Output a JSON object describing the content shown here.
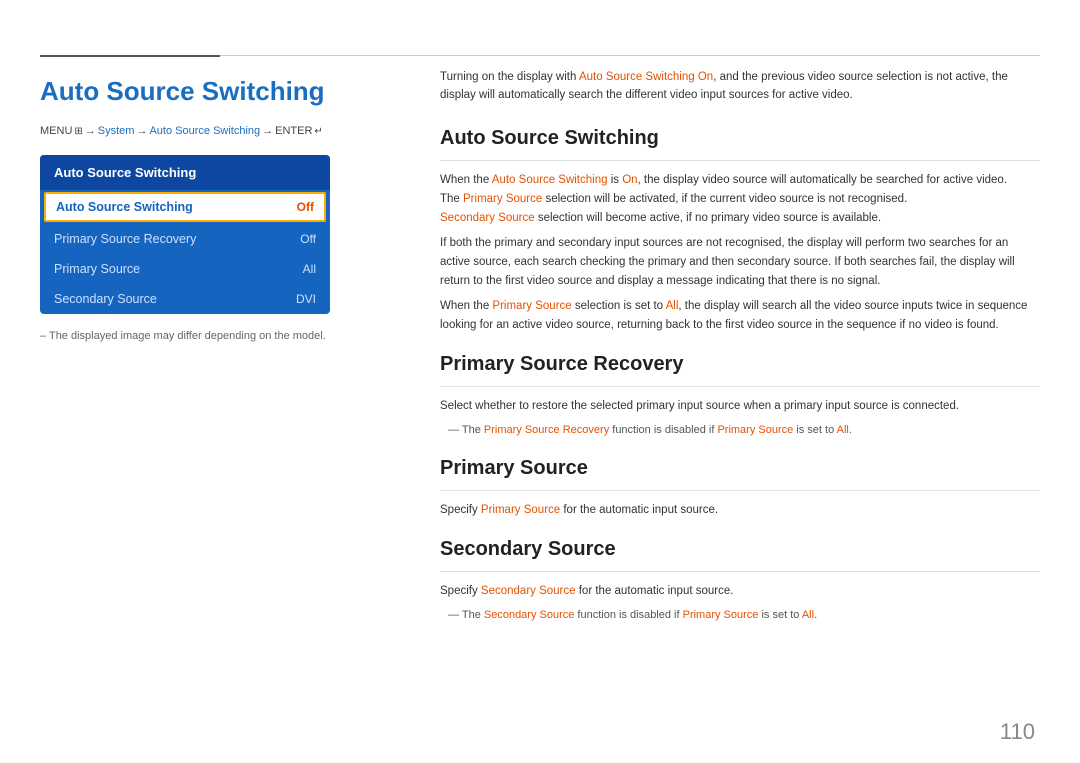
{
  "page": {
    "number": "110"
  },
  "header": {
    "main_title": "Auto Source Switching",
    "breadcrumb": {
      "menu": "MENU",
      "menu_icon": "≡",
      "enter_icon": "↵",
      "arrow": "→",
      "system": "System",
      "auto_source": "Auto Source Switching",
      "enter": "ENTER"
    }
  },
  "menu_panel": {
    "title": "Auto Source Switching",
    "items": [
      {
        "label": "Auto Source Switching",
        "value": "Off",
        "selected": true
      },
      {
        "label": "Primary Source Recovery",
        "value": "Off",
        "selected": false
      },
      {
        "label": "Primary Source",
        "value": "All",
        "selected": false
      },
      {
        "label": "Secondary Source",
        "value": "DVI",
        "selected": false
      }
    ]
  },
  "note": "– The displayed image may differ depending on the model.",
  "intro": {
    "text1": "Turning on the display with ",
    "highlight1": "Auto Source Switching On",
    "text2": ", and the previous video source selection is not active, the display will automatically search the different video input sources for active video."
  },
  "sections": [
    {
      "id": "auto-source-switching",
      "title": "Auto Source Switching",
      "paragraphs": [
        {
          "parts": [
            {
              "text": "When the ",
              "style": "normal"
            },
            {
              "text": "Auto Source Switching",
              "style": "orange"
            },
            {
              "text": " is ",
              "style": "normal"
            },
            {
              "text": "On",
              "style": "orange"
            },
            {
              "text": ", the display video source will automatically be searched for active video.",
              "style": "normal"
            }
          ]
        },
        {
          "parts": [
            {
              "text": "The ",
              "style": "normal"
            },
            {
              "text": "Primary Source",
              "style": "orange"
            },
            {
              "text": " selection will be activated, if the current video source is not recognised.",
              "style": "normal"
            }
          ]
        },
        {
          "parts": [
            {
              "text": "Secondary Source",
              "style": "orange"
            },
            {
              "text": " selection will become active, if no primary video source is available.",
              "style": "normal"
            }
          ]
        },
        {
          "parts": [
            {
              "text": "If both the primary and secondary input sources are not recognised, the display will perform two searches for an active source, each search checking the primary and then secondary source. If both searches fail, the display will return to the first video source and display a message indicating that there is no signal.",
              "style": "normal"
            }
          ]
        },
        {
          "parts": [
            {
              "text": "When the ",
              "style": "normal"
            },
            {
              "text": "Primary Source",
              "style": "orange"
            },
            {
              "text": " selection is set to ",
              "style": "normal"
            },
            {
              "text": "All",
              "style": "orange"
            },
            {
              "text": ", the display will search all the video source inputs twice in sequence looking for an active video source, returning back to the first video source in the sequence if no video is found.",
              "style": "normal"
            }
          ]
        }
      ]
    },
    {
      "id": "primary-source-recovery",
      "title": "Primary Source Recovery",
      "paragraphs": [
        {
          "parts": [
            {
              "text": "Select whether to restore the selected primary input source when a primary input source is connected.",
              "style": "normal"
            }
          ]
        }
      ],
      "note": {
        "parts": [
          {
            "text": "The ",
            "style": "normal"
          },
          {
            "text": "Primary Source Recovery",
            "style": "orange"
          },
          {
            "text": " function is disabled if ",
            "style": "normal"
          },
          {
            "text": "Primary Source",
            "style": "orange"
          },
          {
            "text": " is set to ",
            "style": "normal"
          },
          {
            "text": "All",
            "style": "orange"
          },
          {
            "text": ".",
            "style": "normal"
          }
        ]
      }
    },
    {
      "id": "primary-source",
      "title": "Primary Source",
      "paragraphs": [
        {
          "parts": [
            {
              "text": "Specify ",
              "style": "normal"
            },
            {
              "text": "Primary Source",
              "style": "orange"
            },
            {
              "text": " for the automatic input source.",
              "style": "normal"
            }
          ]
        }
      ]
    },
    {
      "id": "secondary-source",
      "title": "Secondary Source",
      "paragraphs": [
        {
          "parts": [
            {
              "text": "Specify ",
              "style": "normal"
            },
            {
              "text": "Secondary Source",
              "style": "orange"
            },
            {
              "text": " for the automatic input source.",
              "style": "normal"
            }
          ]
        }
      ],
      "note": {
        "parts": [
          {
            "text": "The ",
            "style": "normal"
          },
          {
            "text": "Secondary Source",
            "style": "orange"
          },
          {
            "text": " function is disabled if ",
            "style": "normal"
          },
          {
            "text": "Primary Source",
            "style": "orange"
          },
          {
            "text": " is set to ",
            "style": "normal"
          },
          {
            "text": "All",
            "style": "orange"
          },
          {
            "text": ".",
            "style": "normal"
          }
        ]
      }
    }
  ]
}
